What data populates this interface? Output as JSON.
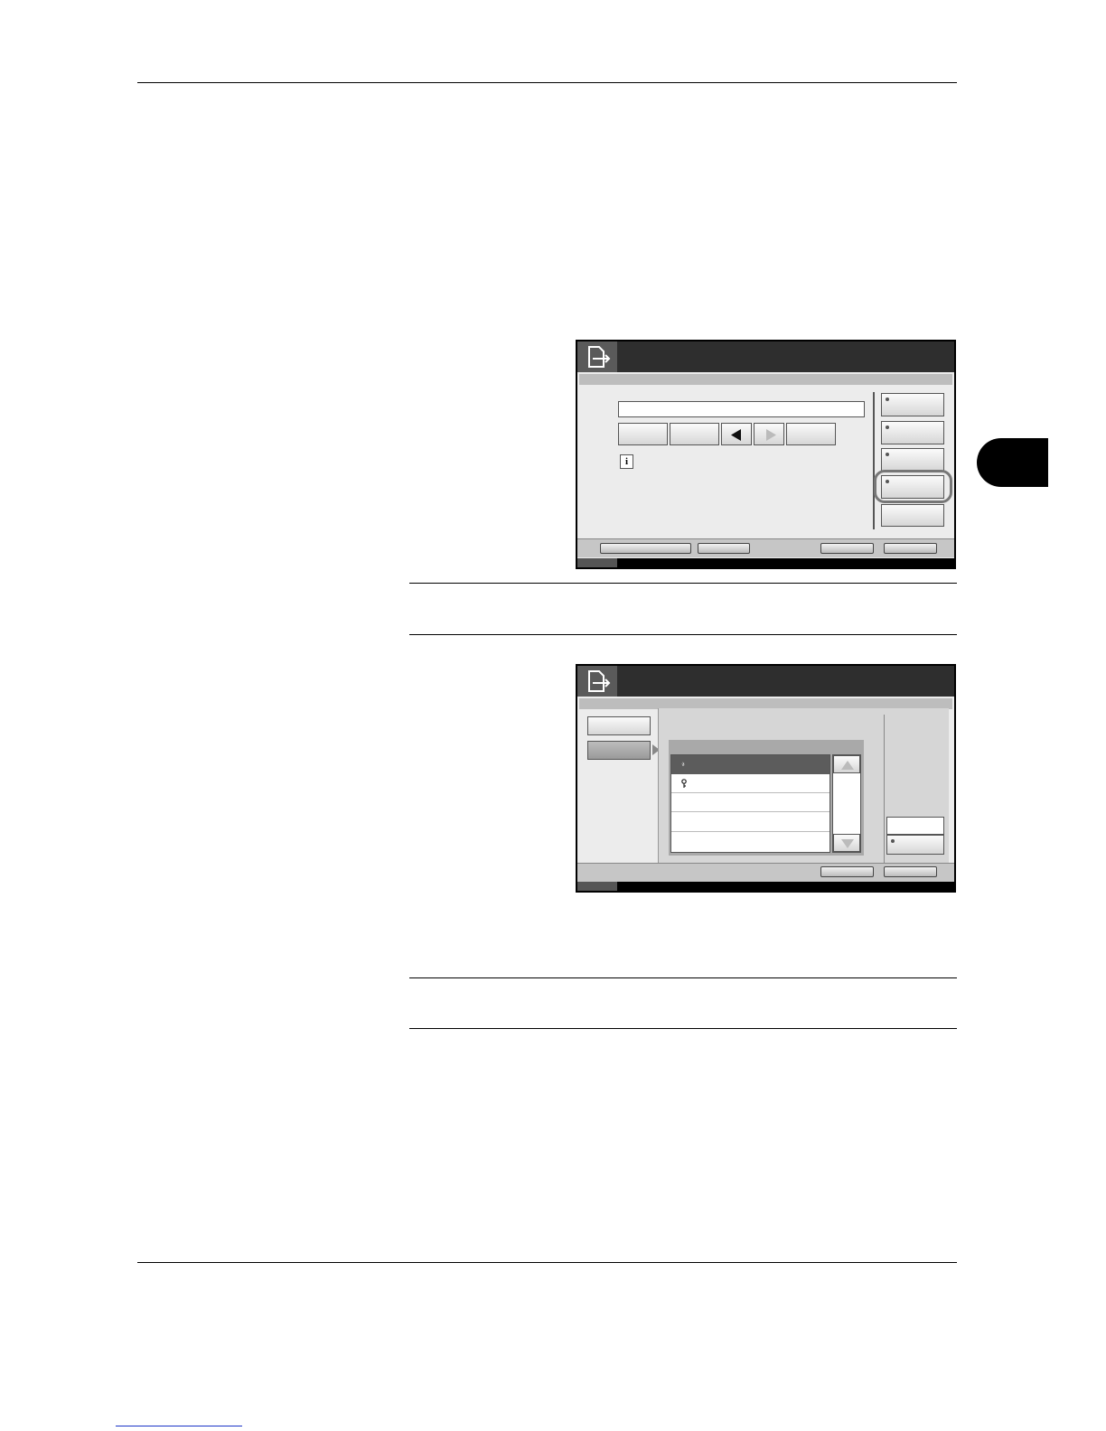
{
  "page": {
    "section_tab_color": "#000000"
  },
  "screen1": {
    "icons": {
      "header": "document-arrow-icon",
      "info": "info-icon",
      "left_arrow": "left-arrow-icon",
      "right_arrow": "right-arrow-icon"
    },
    "highlighted_key_index": 4
  },
  "screen2": {
    "icons": {
      "header": "document-arrow-icon",
      "up": "scroll-up-icon",
      "down": "scroll-down-icon",
      "row_icon": "key-icon"
    }
  },
  "footer": {
    "link_color": "#1a33c8"
  }
}
